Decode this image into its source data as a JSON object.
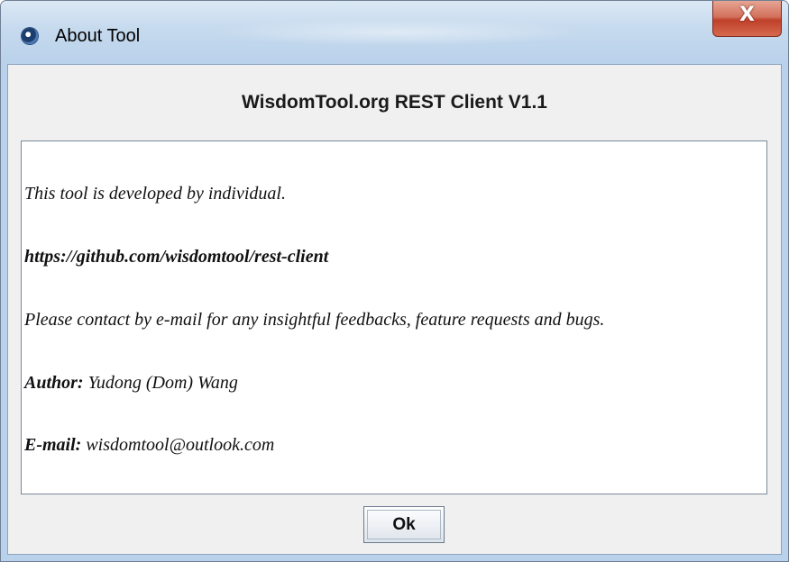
{
  "window": {
    "title": "About Tool",
    "icon": "java-cup-icon",
    "close_icon": "close-icon",
    "close_glyph": "X"
  },
  "header": {
    "title": "WisdomTool.org REST Client V1.1"
  },
  "content": {
    "developed_by": "This tool is developed by individual.",
    "url": "https://github.com/wisdomtool/rest-client",
    "contact": "Please contact by e-mail for any insightful feedbacks, feature requests and bugs.",
    "author_label": "Author:",
    "author_value": " Yudong (Dom) Wang",
    "email_label": "E-mail:",
    "email_value": " wisdomtool@outlook.com"
  },
  "footer": {
    "ok_label": "Ok"
  },
  "colors": {
    "titlebar": "#c6daee",
    "close_button": "#c0402a",
    "client_background": "#f0f0f0"
  }
}
